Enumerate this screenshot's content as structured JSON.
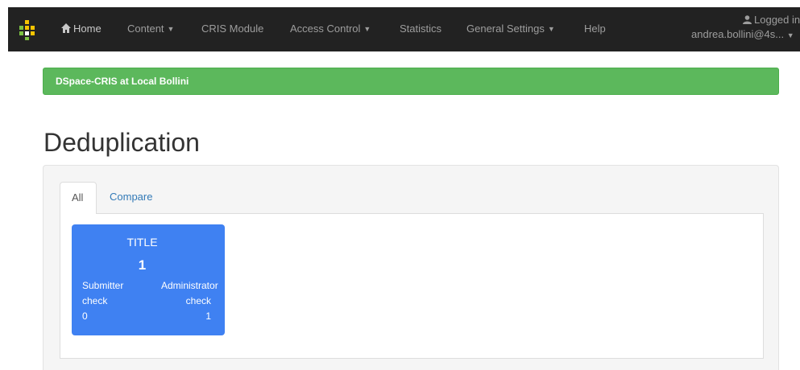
{
  "navbar": {
    "items": [
      {
        "label": "Home"
      },
      {
        "label": "Content",
        "has_caret": true
      },
      {
        "label": "CRIS Module"
      },
      {
        "label": "Access Control",
        "has_caret": true
      },
      {
        "label": "Statistics"
      },
      {
        "label": "General Settings",
        "has_caret": true
      },
      {
        "label": "Help"
      }
    ],
    "user": {
      "status_label": "Logged in as",
      "username": "andrea.bollini@4s..."
    },
    "caret_glyph": "▼",
    "colors": {
      "background": "#222222",
      "text": "#9d9d9d"
    }
  },
  "banner": {
    "text": "DSpace-CRIS at Local Bollini",
    "color": "#5cb85c"
  },
  "page": {
    "title": "Deduplication"
  },
  "tabs": [
    {
      "label": "All",
      "active": true
    },
    {
      "label": "Compare",
      "active": false
    }
  ],
  "cards": [
    {
      "title": "TITLE",
      "count": "1",
      "submitter_label_1": "Submitter",
      "submitter_label_2": "check",
      "submitter_value": "0",
      "admin_label_1": "Administrator",
      "admin_label_2": "check",
      "admin_value": "1",
      "color": "#3f81f2"
    }
  ]
}
